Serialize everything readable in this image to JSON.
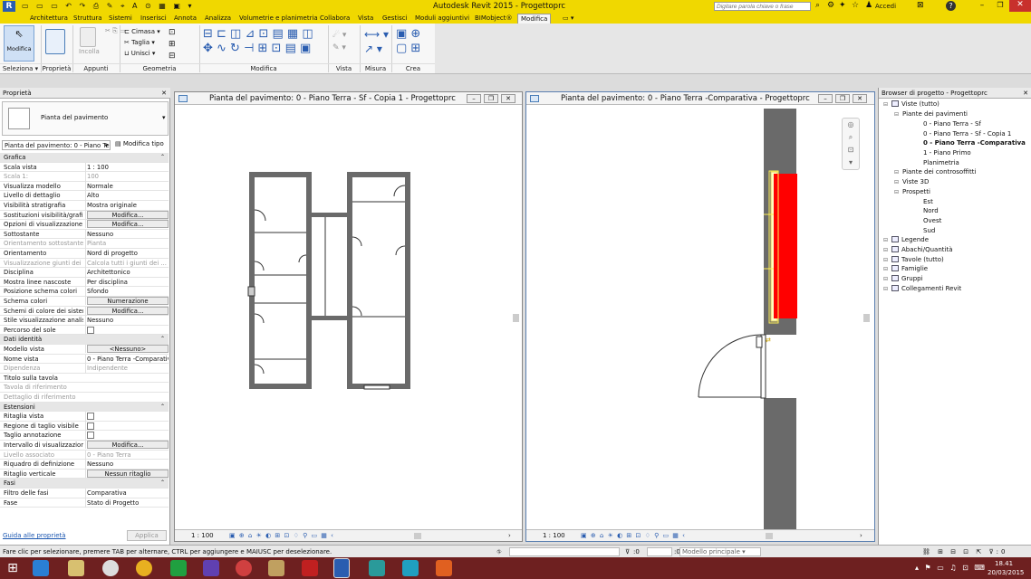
{
  "app": {
    "title": "Autodesk Revit 2015 -    Progettoprc"
  },
  "search": {
    "placeholder": "Digitare parola chiave o frase",
    "user": "Accedi"
  },
  "tabs": [
    "Architettura",
    "Struttura",
    "Sistemi",
    "Inserisci",
    "Annota",
    "Analizza",
    "Volumetrie e planimetria",
    "Collabora",
    "Vista",
    "Gestisci",
    "Moduli aggiuntivi",
    "BIMobject®",
    "Modifica"
  ],
  "ribbon": {
    "modify": "Modifica",
    "paste": "Incolla",
    "cope": "Cimasa",
    "cut": "Taglia",
    "join": "Unisci",
    "groups": [
      "Seleziona ▾",
      "Proprietà",
      "Appunti",
      "Geometria",
      "Modifica",
      "Vista",
      "Misura",
      "Crea"
    ]
  },
  "properties": {
    "header": "Proprietà",
    "type_name": "Pianta del pavimento",
    "selector": "Pianta del pavimento: 0 - Piano Ter",
    "edit_type": "Modifica tipo",
    "rows": [
      {
        "k": "Grafica",
        "v": "",
        "sec": true
      },
      {
        "k": "Scala vista",
        "v": "1 : 100"
      },
      {
        "k": "Scala 1:",
        "v": "100",
        "dis": true
      },
      {
        "k": "Visualizza modello",
        "v": "Normale"
      },
      {
        "k": "Livello di dettaglio",
        "v": "Alto"
      },
      {
        "k": "Visibilità stratigrafia",
        "v": "Mostra originale"
      },
      {
        "k": "Sostituzioni visibilità/grafi...",
        "v": "Modifica...",
        "btn": true
      },
      {
        "k": "Opzioni di visualizzazione ...",
        "v": "Modifica...",
        "btn": true
      },
      {
        "k": "Sottostante",
        "v": "Nessuno"
      },
      {
        "k": "Orientamento sottostante",
        "v": "Pianta",
        "dis": true
      },
      {
        "k": "Orientamento",
        "v": "Nord di progetto"
      },
      {
        "k": "Visualizzazione giunti dei ...",
        "v": "Calcola tutti i giunti dei ...",
        "dis": true
      },
      {
        "k": "Disciplina",
        "v": "Architettonico"
      },
      {
        "k": "Mostra linee nascoste",
        "v": "Per disciplina"
      },
      {
        "k": "Posizione schema colori",
        "v": "Sfondo"
      },
      {
        "k": "Schema colori",
        "v": "Numerazione",
        "btn": true
      },
      {
        "k": "Schemi di colore dei sistemi",
        "v": "Modifica...",
        "btn": true
      },
      {
        "k": "Stile visualizzazione analis...",
        "v": "Nessuno"
      },
      {
        "k": "Percorso del sole",
        "v": "",
        "chk": true
      },
      {
        "k": "Dati identità",
        "v": "",
        "sec": true
      },
      {
        "k": "Modello vista",
        "v": "<Nessuno>",
        "btn": true
      },
      {
        "k": "Nome vista",
        "v": "0 - Piano Terra -Comparativa"
      },
      {
        "k": "Dipendenza",
        "v": "Indipendente",
        "dis": true
      },
      {
        "k": "Titolo sulla tavola",
        "v": ""
      },
      {
        "k": "Tavola di riferimento",
        "v": "",
        "dis": true
      },
      {
        "k": "Dettaglio di riferimento",
        "v": "",
        "dis": true
      },
      {
        "k": "Estensioni",
        "v": "",
        "sec": true
      },
      {
        "k": "Ritaglia vista",
        "v": "",
        "chk": true
      },
      {
        "k": "Regione di taglio visibile",
        "v": "",
        "chk": true
      },
      {
        "k": "Taglio annotazione",
        "v": "",
        "chk": true
      },
      {
        "k": "Intervallo di visualizzazione",
        "v": "Modifica...",
        "btn": true
      },
      {
        "k": "Livello associato",
        "v": "0 - Piano Terra",
        "dis": true
      },
      {
        "k": "Riquadro di definizione",
        "v": "Nessuno"
      },
      {
        "k": "Ritaglio verticale",
        "v": "Nessun ritaglio",
        "btn": true
      },
      {
        "k": "Fasi",
        "v": "",
        "sec": true
      },
      {
        "k": "Filtro delle fasi",
        "v": "Comparativa"
      },
      {
        "k": "Fase",
        "v": "Stato di Progetto"
      }
    ],
    "help_link": "Guida alle proprietà",
    "apply": "Applica"
  },
  "view1": {
    "title": "Pianta del pavimento: 0 - Piano Terra - Sf - Copia 1 - Progettoprc",
    "scale": "1 : 100"
  },
  "view2": {
    "title": "Pianta del pavimento: 0 - Piano Terra -Comparativa - Progettoprc",
    "scale": "1 : 100"
  },
  "browser": {
    "header": "Browser di progetto - Progettoprc",
    "items": [
      {
        "t": "Viste (tutto)",
        "lvl": 0
      },
      {
        "t": "Piante dei pavimenti",
        "lvl": 1
      },
      {
        "t": "0 - Piano Terra - Sf",
        "lvl": 2
      },
      {
        "t": "0 - Piano Terra - Sf - Copia 1",
        "lvl": 2
      },
      {
        "t": "0 - Piano Terra -Comparativa",
        "lvl": 2,
        "b": true
      },
      {
        "t": "1 - Piano Primo",
        "lvl": 2
      },
      {
        "t": "Planimetria",
        "lvl": 2
      },
      {
        "t": "Piante dei controsoffitti",
        "lvl": 1
      },
      {
        "t": "Viste 3D",
        "lvl": 1
      },
      {
        "t": "Prospetti",
        "lvl": 1
      },
      {
        "t": "Est",
        "lvl": 2
      },
      {
        "t": "Nord",
        "lvl": 2
      },
      {
        "t": "Ovest",
        "lvl": 2
      },
      {
        "t": "Sud",
        "lvl": 2
      },
      {
        "t": "Legende",
        "lvl": 0
      },
      {
        "t": "Abachi/Quantità",
        "lvl": 0
      },
      {
        "t": "Tavole (tutto)",
        "lvl": 0
      },
      {
        "t": "Famiglie",
        "lvl": 0
      },
      {
        "t": "Gruppi",
        "lvl": 0
      },
      {
        "t": "Collegamenti Revit",
        "lvl": 0
      }
    ]
  },
  "status": {
    "text": "Fare clic per selezionare, premere TAB per alternare, CTRL per aggiungere e MAIUSC per deselezionare.",
    "zero1": ":0",
    "zero2": ":0",
    "model": "Modello principale"
  },
  "clock": {
    "time": "18.41",
    "date": "20/03/2015"
  },
  "colors": {
    "ribbonYellow": "#f0d800",
    "selection": "#ff0000",
    "taskbar": "#6e2020"
  }
}
